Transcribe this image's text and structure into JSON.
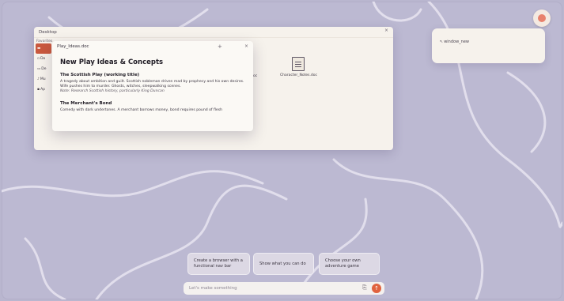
{
  "desktop_window": {
    "title": "Desktop",
    "close_glyph": "×",
    "sidebar": {
      "favorites_label": "Favorites",
      "items": [
        {
          "icon": "home-icon",
          "label": ""
        },
        {
          "icon": "document-icon",
          "label": "Do"
        },
        {
          "icon": "desktop-icon",
          "label": "De"
        },
        {
          "icon": "music-icon",
          "label": "Mu"
        },
        {
          "icon": "apps-icon",
          "label": "Ap"
        }
      ]
    },
    "files": [
      {
        "icon": "document-icon",
        "label": "Character_Notes.doc"
      }
    ],
    "partial_label": "oc"
  },
  "doc_window": {
    "tab_title": "Play_Ideas.doc",
    "plus_glyph": "+",
    "close_glyph": "×",
    "heading": "New Play Ideas & Concepts",
    "sections": [
      {
        "title": "The Scottish Play (working title)",
        "body": "A tragedy about ambition and guilt. Scottish nobleman driven mad by prophecy and his own desires. Wife pushes him to murder. Ghosts, witches, sleepwalking scenes.",
        "note": "Note: Research Scottish history, particularly King Duncan"
      },
      {
        "title": "The Merchant's Bond",
        "body": "Comedy with dark undertones. A merchant borrows money, bond requires pound of flesh",
        "note": ""
      }
    ]
  },
  "side_panel": {
    "label": "window_new"
  },
  "suggestions": [
    {
      "label": "Create a browser with a functional nav bar"
    },
    {
      "label": "Show what you can do"
    },
    {
      "label": "Choose your own adventure game"
    }
  ],
  "prompt": {
    "placeholder": "Let's make something",
    "send_glyph": "↑"
  },
  "colors": {
    "background": "#bcb9d2",
    "accent": "#e0623f",
    "selected_sidebar": "#c9583e",
    "panel": "#f6f2ec"
  }
}
